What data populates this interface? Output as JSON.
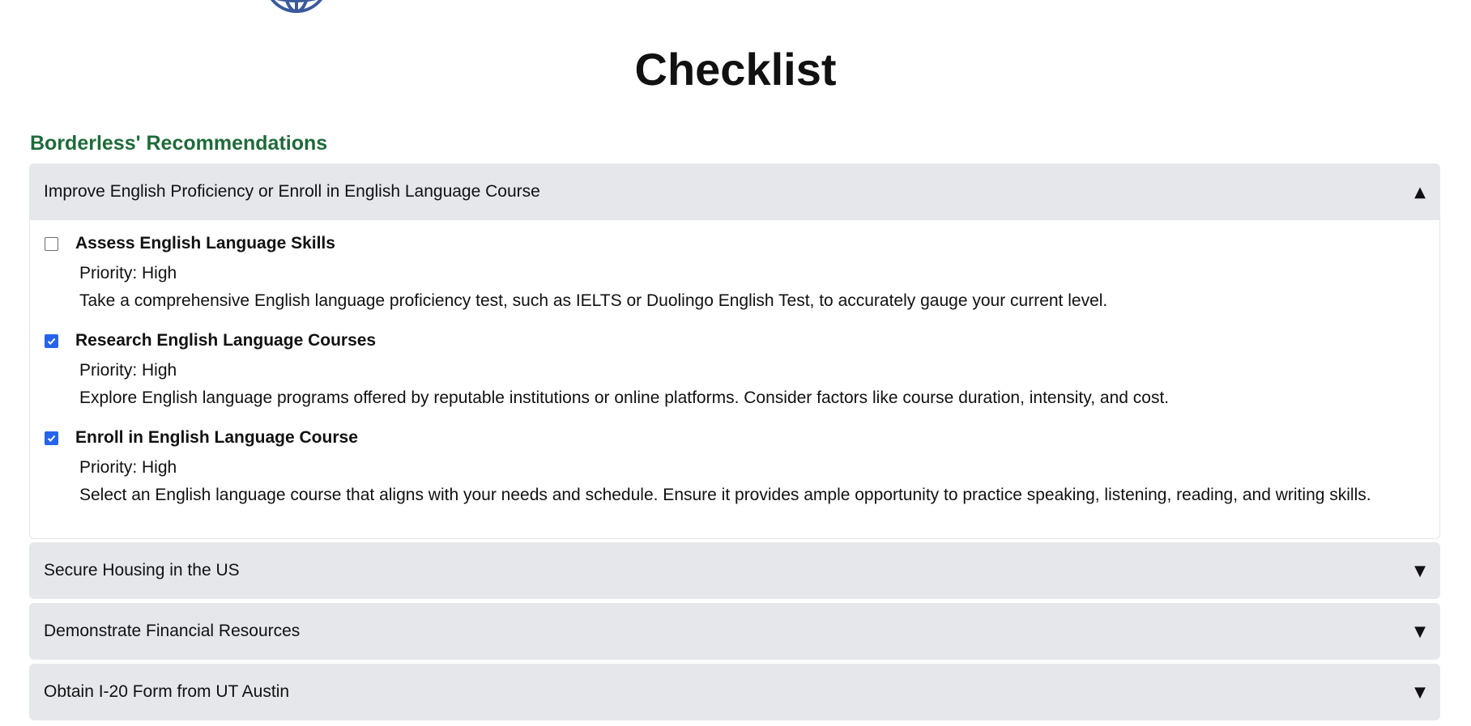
{
  "page_title": "Checklist",
  "section_heading": "Borderless' Recommendations",
  "colors": {
    "heading_green": "#1f6a3a",
    "checkbox_blue": "#2563eb",
    "accordion_bg": "#e5e7eb",
    "logo_blue": "#3a5a9b"
  },
  "logo": {
    "icon": "globe-icon"
  },
  "accordions": [
    {
      "title": "Improve English Proficiency or Enroll in English Language Course",
      "arrow": "▲",
      "expanded": true,
      "tasks": [
        {
          "name": "Assess English Language Skills",
          "checked": false,
          "priority": "Priority: High",
          "description": "Take a comprehensive English language proficiency test, such as IELTS or Duolingo English Test, to accurately gauge your current level."
        },
        {
          "name": "Research English Language Courses",
          "checked": true,
          "priority": "Priority: High",
          "description": "Explore English language programs offered by reputable institutions or online platforms. Consider factors like course duration, intensity, and cost."
        },
        {
          "name": "Enroll in English Language Course",
          "checked": true,
          "priority": "Priority: High",
          "description": "Select an English language course that aligns with your needs and schedule. Ensure it provides ample opportunity to practice speaking, listening, reading, and writing skills."
        }
      ]
    },
    {
      "title": "Secure Housing in the US",
      "arrow": "▼",
      "expanded": false
    },
    {
      "title": "Demonstrate Financial Resources",
      "arrow": "▼",
      "expanded": false
    },
    {
      "title": "Obtain I-20 Form from UT Austin",
      "arrow": "▼",
      "expanded": false
    }
  ]
}
